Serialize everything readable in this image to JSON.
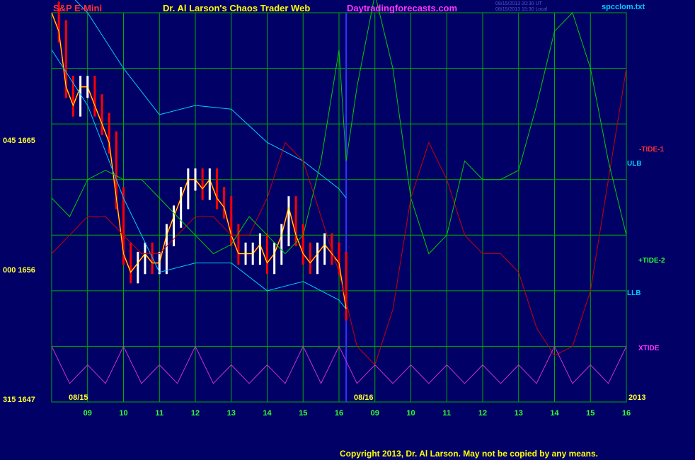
{
  "header": {
    "instrument": "S&P E-Mini",
    "title": "Dr. Al Larson's Chaos Trader Web",
    "site": "Daytradingforecasts.com",
    "file": "spcclom.txt",
    "stamp_1": "08/15/2013 20:30 UT",
    "stamp_2": "08/15/2013 15:30 Local"
  },
  "y_axis": {
    "top": "045  1665",
    "mid": "000  1656",
    "bot": "315  1647"
  },
  "x_axis": {
    "date_1": "08/15",
    "date_2": "08/16",
    "year": "2013",
    "ticks": [
      "09",
      "10",
      "11",
      "12",
      "13",
      "14",
      "15",
      "16",
      "09",
      "10",
      "11",
      "12",
      "13",
      "14",
      "15",
      "16"
    ]
  },
  "right_labels": {
    "tide1": "-TIDE-1",
    "ulb": "ULB",
    "tide2": "+TIDE-2",
    "llb": "LLB",
    "xtide": "XTIDE"
  },
  "colors": {
    "background": "#000066",
    "grid": "#00aa00",
    "price_down": "#ff0000",
    "price_up": "#ffffff",
    "price_line": "#ffff00",
    "bands": "#00ccff",
    "tide1": "#cc0000",
    "tide2": "#00cc00",
    "xtide": "#cc33cc",
    "now_line": "#3333ff"
  },
  "footer": {
    "copyright": "Copyright 2013, Dr. Al Larson. May not be copied by any means."
  },
  "chart_data": {
    "type": "line",
    "title": "S&P E-Mini",
    "x_unit": "hour",
    "ylim": [
      1647,
      1668
    ],
    "yticks": [
      1647,
      1656,
      1665
    ],
    "grid": true,
    "now_x": 16.2,
    "series": [
      {
        "name": "Price",
        "x": [
          8.0,
          8.2,
          8.4,
          8.6,
          8.8,
          9.0,
          9.2,
          9.4,
          9.6,
          9.8,
          10.0,
          10.2,
          10.4,
          10.6,
          10.8,
          11.0,
          11.2,
          11.4,
          11.6,
          11.8,
          12.0,
          12.2,
          12.4,
          12.6,
          12.8,
          13.0,
          13.2,
          13.4,
          13.6,
          13.8,
          14.0,
          14.2,
          14.4,
          14.6,
          14.8,
          15.0,
          15.2,
          15.4,
          15.6,
          15.8,
          16.0,
          16.2
        ],
        "values": [
          1668,
          1667,
          1664,
          1663,
          1664,
          1664,
          1663,
          1662,
          1661,
          1658,
          1655,
          1654,
          1654.5,
          1655,
          1654.5,
          1654.5,
          1656,
          1657,
          1658,
          1659,
          1659,
          1658.5,
          1659,
          1658,
          1657.5,
          1656,
          1655,
          1655,
          1655,
          1655.5,
          1654.5,
          1655,
          1656,
          1657.5,
          1656,
          1655,
          1654.5,
          1655,
          1655.5,
          1655,
          1654.5,
          1652
        ]
      },
      {
        "name": "ULB",
        "x": [
          8.0,
          9.0,
          10.0,
          11.0,
          12.0,
          13.0,
          14.0,
          15.0,
          16.0,
          16.2
        ],
        "values": [
          1670,
          1668,
          1665,
          1662.5,
          1663,
          1662.8,
          1661,
          1660,
          1658.5,
          1658
        ]
      },
      {
        "name": "LLB",
        "x": [
          8.0,
          9.0,
          10.0,
          11.0,
          12.0,
          13.0,
          14.0,
          15.0,
          16.0,
          16.2
        ],
        "values": [
          1666,
          1663,
          1658,
          1654,
          1654.5,
          1654.5,
          1653,
          1653.5,
          1652.5,
          1652
        ]
      },
      {
        "name": "TIDE-1",
        "x": [
          8.0,
          8.5,
          9.0,
          9.5,
          10.0,
          10.5,
          11.0,
          11.5,
          12.0,
          12.5,
          13.0,
          13.5,
          14.0,
          14.5,
          15.0,
          15.5,
          16.0,
          16.5,
          17.0,
          17.5,
          18.0,
          18.5,
          19.0,
          19.5,
          20.0,
          20.5,
          21.0,
          21.5,
          22.0,
          22.5,
          23.0,
          23.5,
          24.0
        ],
        "values": [
          1655,
          1656,
          1657,
          1657,
          1656,
          1655,
          1655,
          1656,
          1657,
          1657,
          1656,
          1656,
          1658,
          1661,
          1660,
          1657,
          1654,
          1650,
          1649,
          1652,
          1658,
          1661,
          1659,
          1656,
          1655,
          1655,
          1654,
          1651,
          1649.5,
          1650,
          1653,
          1659,
          1665
        ]
      },
      {
        "name": "TIDE-2",
        "x": [
          8.0,
          8.5,
          9.0,
          9.5,
          10.0,
          10.5,
          11.0,
          11.5,
          12.0,
          12.5,
          13.0,
          13.5,
          14.0,
          14.5,
          15.0,
          15.5,
          16.0,
          16.2,
          16.5,
          17.0,
          17.5,
          18.0,
          18.5,
          19.0,
          19.5,
          20.0,
          20.5,
          21.0,
          21.5,
          22.0,
          22.5,
          23.0,
          23.5,
          24.0
        ],
        "values": [
          1658,
          1657,
          1659,
          1659.5,
          1659,
          1659,
          1658,
          1657,
          1656,
          1655,
          1655.5,
          1657,
          1656,
          1655,
          1656,
          1660,
          1666,
          1660,
          1664,
          1669,
          1665,
          1658,
          1655,
          1656,
          1660,
          1659,
          1659,
          1659.5,
          1663,
          1667,
          1668,
          1665,
          1660,
          1656
        ]
      },
      {
        "name": "XTIDE",
        "x": [
          8.0,
          8.5,
          9.0,
          9.5,
          10.0,
          10.5,
          11.0,
          11.5,
          12.0,
          12.5,
          13.0,
          13.5,
          14.0,
          14.5,
          15.0,
          15.5,
          16.0,
          16.5,
          17.0,
          17.5,
          18.0,
          18.5,
          19.0,
          19.5,
          20.0,
          20.5,
          21.0,
          21.5,
          22.0,
          22.5,
          23.0,
          23.5,
          24.0
        ],
        "values": [
          1650,
          1648,
          1649,
          1648,
          1650,
          1648,
          1649,
          1648,
          1650,
          1648,
          1649,
          1648,
          1649,
          1648,
          1650,
          1648,
          1650,
          1648,
          1649,
          1648,
          1649,
          1648,
          1649,
          1648,
          1649,
          1648,
          1649,
          1648,
          1650,
          1648,
          1649,
          1648,
          1650
        ]
      }
    ]
  }
}
